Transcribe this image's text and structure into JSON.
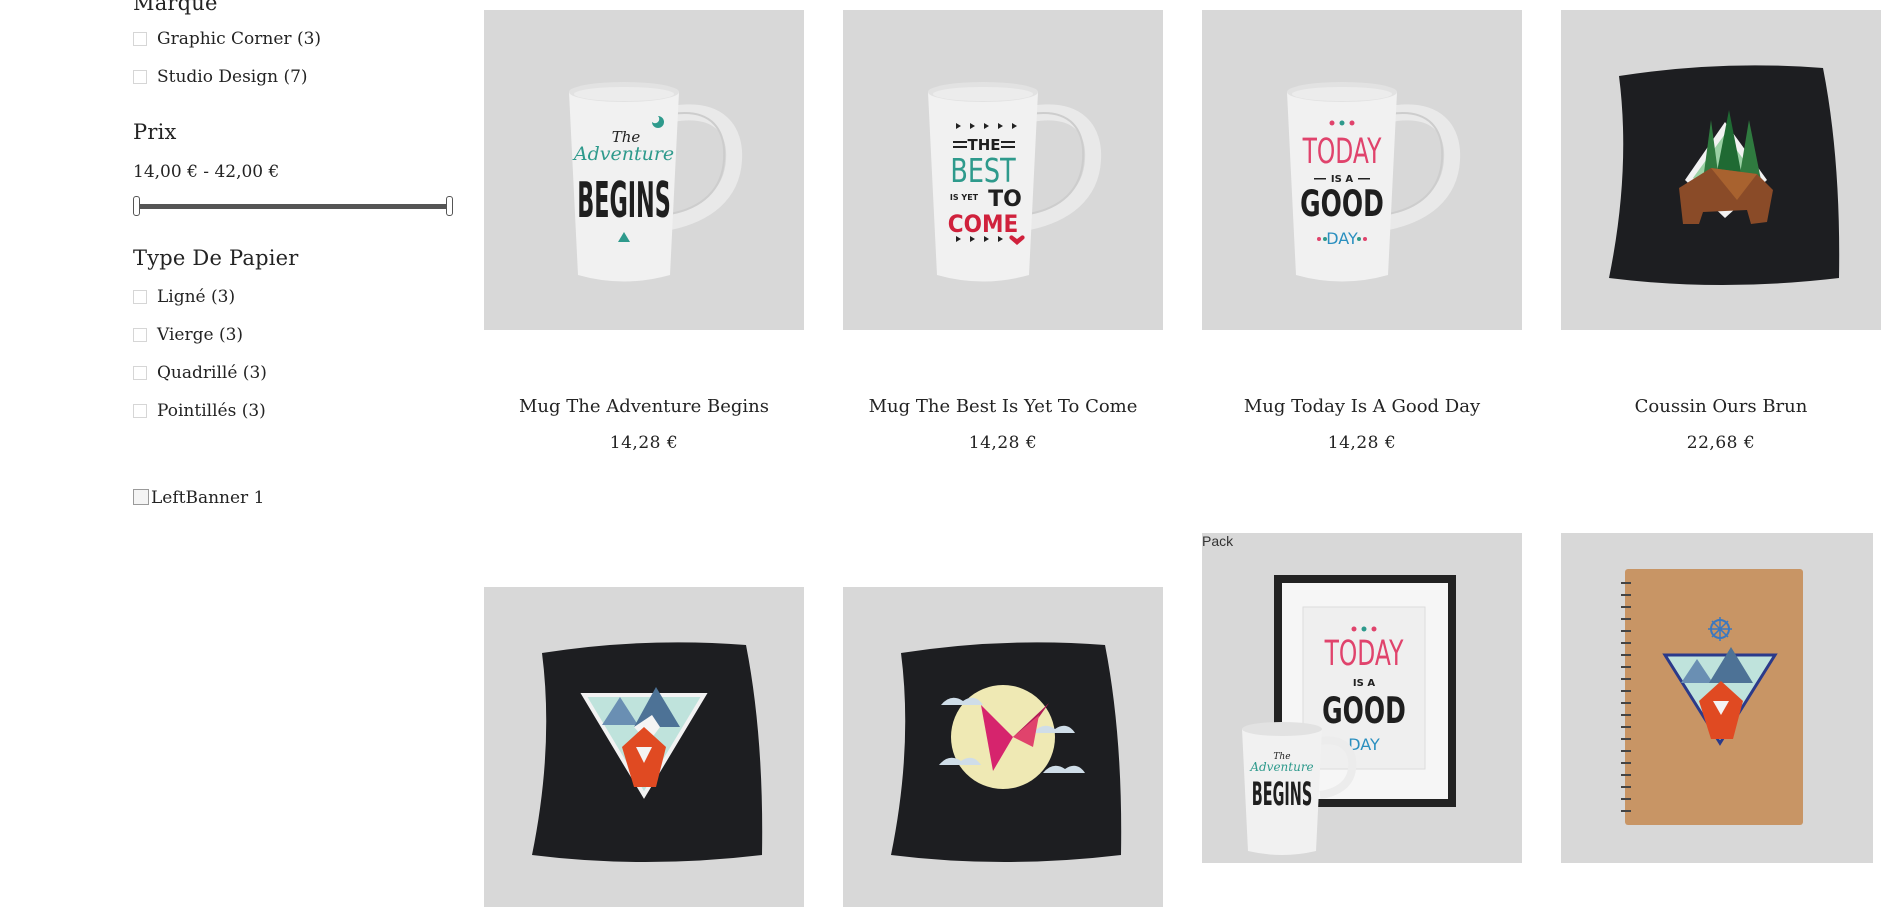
{
  "sidebar": {
    "brand": {
      "title": "Marque",
      "items": [
        {
          "label": "Graphic Corner (3)"
        },
        {
          "label": "Studio Design (7)"
        }
      ]
    },
    "price": {
      "title": "Prix",
      "range_text": "14,00 € - 42,00 €",
      "min": 14,
      "max": 42,
      "selected_min": 14,
      "selected_max": 42
    },
    "paper": {
      "title": "Type De Papier",
      "items": [
        {
          "label": "Ligné (3)"
        },
        {
          "label": "Vierge (3)"
        },
        {
          "label": "Quadrillé (3)"
        },
        {
          "label": "Pointillés (3)"
        }
      ]
    },
    "banner_alt": "LeftBanner 1"
  },
  "products": [
    {
      "name": "Mug The Adventure Begins",
      "price": "14,28 €",
      "image": "mug-adventure-image"
    },
    {
      "name": "Mug The Best Is Yet To Come",
      "price": "14,28 €",
      "image": "mug-best-image"
    },
    {
      "name": "Mug Today Is A Good Day",
      "price": "14,28 €",
      "image": "mug-today-image"
    },
    {
      "name": "Coussin Ours Brun",
      "price": "22,68 €",
      "image": "cushion-bear-image"
    },
    {
      "name": "",
      "price": "",
      "image": "cushion-fox-image"
    },
    {
      "name": "",
      "price": "",
      "image": "cushion-hummingbird-image"
    },
    {
      "name": "",
      "price": "",
      "image": "pack-poster-mug-image",
      "badge": "Pack"
    },
    {
      "name": "",
      "price": "",
      "image": "notebook-fox-image"
    }
  ],
  "mug_art": {
    "adventure": {
      "line1": "The",
      "line2": "Adventure",
      "line3": "BEGINS"
    },
    "best": {
      "line1": "THE",
      "line2": "BEST",
      "line3": "IS YET",
      "line4": "TO",
      "line5": "COME"
    },
    "today": {
      "line1": "TODAY",
      "line2": "IS A",
      "line3": "GOOD",
      "line4": "DAY"
    }
  },
  "colors": {
    "thumb_bg": "#d8d8d8",
    "teal": "#2e9a8c",
    "red": "#d0213c",
    "pink": "#e0436c",
    "blue": "#2a8fbf",
    "dark": "#1f1f1f"
  }
}
